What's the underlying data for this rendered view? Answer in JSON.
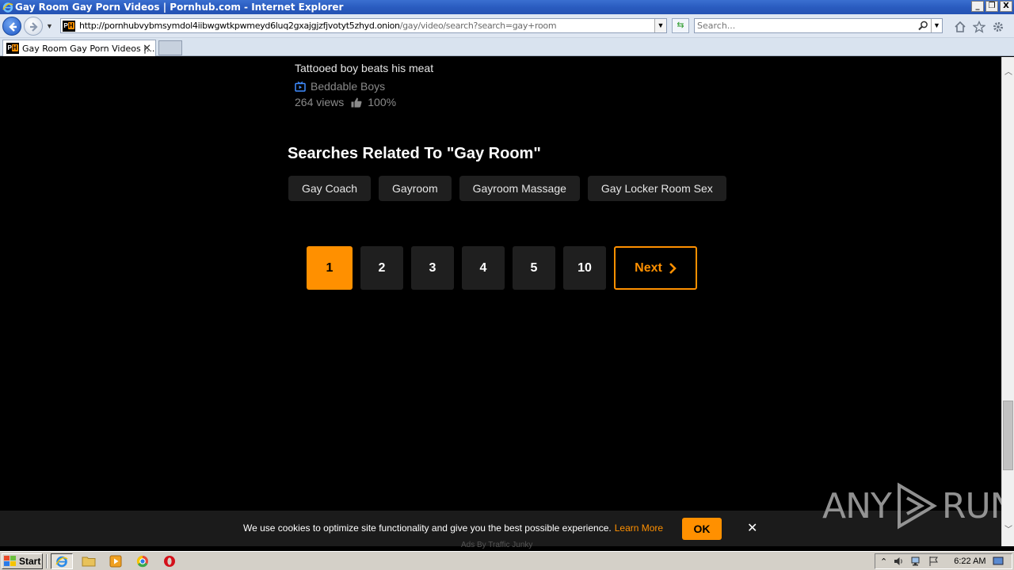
{
  "window": {
    "title": "Gay Room Gay Porn Videos | Pornhub.com - Internet Explorer",
    "controls": [
      "_",
      "❐",
      "X"
    ]
  },
  "address": {
    "url_host": "http://pornhubvybmsymdol4iibwgwtkpwmeyd6luq2gxajgjzfjvotyt5zhyd.onion",
    "url_path": "/gay/video/search?search=gay+room",
    "search_placeholder": "Search..."
  },
  "tab": {
    "favicon": "PH",
    "title": "Gay Room Gay Porn Videos |...",
    "close": "✕"
  },
  "video": {
    "title": "Tattooed boy beats his meat",
    "channel": "Beddable Boys",
    "views": "264 views",
    "rating": "100%"
  },
  "related": {
    "heading": "Searches Related To \"Gay Room\"",
    "items": [
      "Gay Coach",
      "Gayroom",
      "Gayroom Massage",
      "Gay Locker Room Sex"
    ]
  },
  "pagination": {
    "pages": [
      "1",
      "2",
      "3",
      "4",
      "5",
      "10"
    ],
    "current": "1",
    "next_label": "Next"
  },
  "cookie": {
    "text": "We use cookies to optimize site functionality and give you the best possible experience.",
    "link": "Learn More",
    "ok": "OK",
    "close": "✕",
    "ads": "Ads By Traffic Junky"
  },
  "watermark": {
    "left": "ANY",
    "right": "RUN"
  },
  "taskbar": {
    "start": "Start",
    "clock": "6:22 AM"
  },
  "colors": {
    "accent": "#ff9000",
    "pill_bg": "#1f1f1f",
    "page_bg": "#000000"
  }
}
